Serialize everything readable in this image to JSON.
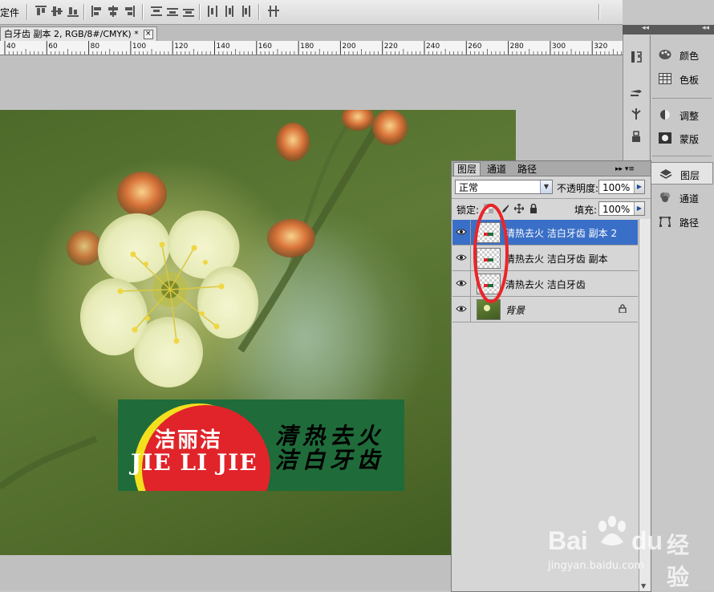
{
  "options_bar": {
    "label": "定件"
  },
  "document": {
    "tab_title": "白牙齿 副本 2, RGB/8#/CMYK) *",
    "close_glyph": "×"
  },
  "ruler": {
    "ticks": [
      "40",
      "60",
      "80",
      "100",
      "120",
      "140",
      "160",
      "180",
      "200",
      "220",
      "240",
      "260",
      "280",
      "300",
      "320"
    ]
  },
  "banner": {
    "brand_cn": "洁丽洁",
    "brand_en": "JIE LI JIE",
    "slogan_line1": "清热去火",
    "slogan_line2": "洁白牙齿",
    "colors": {
      "background": "#1f6b3a",
      "logo_red": "#e0242a",
      "logo_yellow": "#f2e01e"
    }
  },
  "dock": {
    "collapse_glyph": "◂◂",
    "items": [
      {
        "label": "颜色",
        "icon": "palette-icon"
      },
      {
        "label": "色板",
        "icon": "swatches-icon"
      },
      {
        "label": "调整",
        "icon": "adjustments-icon"
      },
      {
        "label": "蒙版",
        "icon": "masks-icon"
      },
      {
        "label": "图层",
        "icon": "layers-icon"
      },
      {
        "label": "通道",
        "icon": "channels-icon"
      },
      {
        "label": "路径",
        "icon": "paths-icon"
      }
    ]
  },
  "layers_panel": {
    "tabs": [
      "图层",
      "通道",
      "路径"
    ],
    "menu_glyph": "▸▸ ▾≡",
    "blend_mode": "正常",
    "opacity_label": "不透明度:",
    "opacity_value": "100%",
    "lock_label": "锁定:",
    "fill_label": "填充:",
    "fill_value": "100%",
    "layers": [
      {
        "name": "清热去火 洁白牙齿 副本 2",
        "selected": true
      },
      {
        "name": "清热去火 洁白牙齿 副本",
        "selected": false
      },
      {
        "name": "清热去火 洁白牙齿",
        "selected": false
      },
      {
        "name": "背景",
        "selected": false,
        "locked": true
      }
    ],
    "annotation_color": "#e8262a"
  },
  "watermark": {
    "brand": "Bai",
    "brand2": "du",
    "cn": "经验",
    "url": "jingyan.baidu.com"
  }
}
